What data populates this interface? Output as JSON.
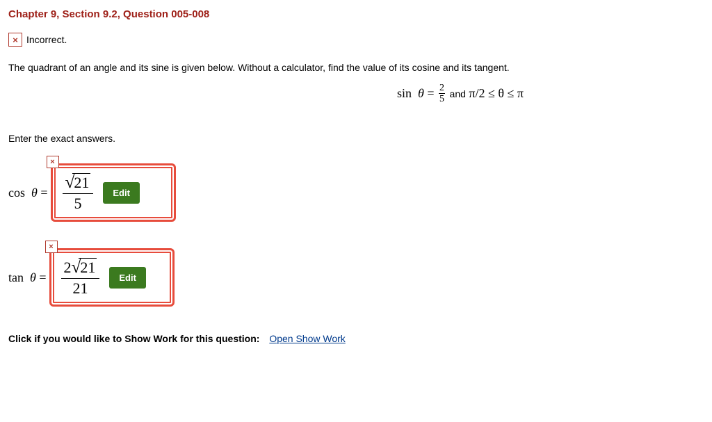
{
  "title": "Chapter 9, Section 9.2, Question 005-008",
  "status": {
    "icon": "×",
    "text": "Incorrect."
  },
  "prompt": "The quadrant of an angle and its sine is given below. Without a calculator, find the value of its cosine and its tangent.",
  "given": {
    "func": "sin",
    "var": "θ",
    "equals": "=",
    "frac_num": "2",
    "frac_den": "5",
    "and": "and",
    "range": "π/2 ≤ θ ≤ π"
  },
  "instruction": "Enter the exact answers.",
  "answers": [
    {
      "label_func": "cos",
      "label_var": "θ",
      "label_eq": "=",
      "marker": "×",
      "expr": {
        "pre": "",
        "sqrt_inner": "21",
        "den": "5"
      },
      "edit": "Edit"
    },
    {
      "label_func": "tan",
      "label_var": "θ",
      "label_eq": "=",
      "marker": "×",
      "expr": {
        "pre": "2",
        "sqrt_inner": "21",
        "den": "21"
      },
      "edit": "Edit"
    }
  ],
  "show_work": {
    "label": "Click if you would like to Show Work for this question:",
    "link": "Open Show Work"
  }
}
